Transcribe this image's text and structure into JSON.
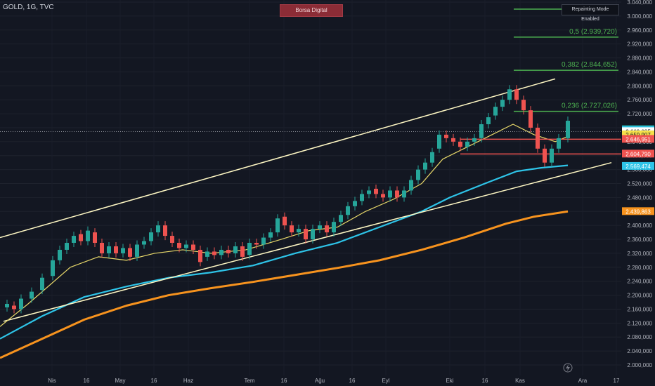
{
  "header": {
    "title": "GOLD, 1G, TVC"
  },
  "badges": {
    "brand": "Borsa Digital",
    "repainting": "Repainting Mode Enabled"
  },
  "colors": {
    "background": "#131722",
    "up": "#26a69a",
    "down": "#ef5350",
    "ema_fast": "#e8d86a",
    "ema_slow": "#2ec4e8",
    "ema_long": "#f7931e",
    "channel": "#fff8c4",
    "fib": "#4caf50"
  },
  "icons": {
    "lightning": "lightning-icon"
  },
  "chart_data": {
    "type": "candlestick",
    "y_axis": {
      "range": [
        1990,
        3040
      ],
      "ticks": [
        "3.040,000",
        "3.000,000",
        "2.960,000",
        "2.920,000",
        "2.880,000",
        "2.840,000",
        "2.800,000",
        "2.760,000",
        "2.720,000",
        "2.680,000",
        "2.640,000",
        "2.600,000",
        "2.560,000",
        "2.520,000",
        "2.480,000",
        "2.440,000",
        "2.400,000",
        "2.360,000",
        "2.320,000",
        "2.280,000",
        "2.240,000",
        "2.200,000",
        "2.160,000",
        "2.120,000",
        "2.080,000",
        "2.040,000",
        "2.000,000"
      ]
    },
    "x_axis": {
      "ticks": [
        "Nis",
        "16",
        "May",
        "16",
        "Haz",
        "Tem",
        "16",
        "Ağu",
        "16",
        "Eyl",
        "Eki",
        "16",
        "Kas",
        "Ara",
        "17"
      ]
    },
    "fibonacci": [
      {
        "label": "0,5 (2.939,720)",
        "value": 2939.72
      },
      {
        "label": "0,382 (2.844,652)",
        "value": 2844.652
      },
      {
        "label": "0,236 (2.727,026)",
        "value": 2727.026
      }
    ],
    "price_labels": [
      {
        "text": "2.674,709",
        "value": 2674.709,
        "color": "#26a69a"
      },
      {
        "text": "2.672,699",
        "value": 2672.699,
        "color": "#2ec4e8"
      },
      {
        "text": "2.669,085",
        "value": 2669.085,
        "color": "#ffffff"
      },
      {
        "text": "2.659,907",
        "value": 2659.907,
        "color": "#f5e04a"
      },
      {
        "text": "2.646,951",
        "value": 2646.951,
        "color": "#ef5350"
      },
      {
        "text": "2.604,790",
        "value": 2604.79,
        "color": "#ef5350"
      },
      {
        "text": "2.569,474",
        "value": 2569.474,
        "color": "#2ec4e8"
      },
      {
        "text": "2.439,863",
        "value": 2439.863,
        "color": "#f7931e"
      }
    ],
    "red_levels": [
      2646.951,
      2604.79
    ],
    "current_price": 2669.085,
    "ema_long": [
      [
        0,
        2020
      ],
      [
        60,
        2075
      ],
      [
        120,
        2130
      ],
      [
        180,
        2170
      ],
      [
        240,
        2200
      ],
      [
        300,
        2220
      ],
      [
        360,
        2238
      ],
      [
        420,
        2258
      ],
      [
        480,
        2278
      ],
      [
        540,
        2300
      ],
      [
        600,
        2330
      ],
      [
        660,
        2365
      ],
      [
        720,
        2405
      ],
      [
        760,
        2425
      ],
      [
        808,
        2440
      ]
    ],
    "ema_slow": [
      [
        0,
        2075
      ],
      [
        60,
        2140
      ],
      [
        120,
        2195
      ],
      [
        180,
        2225
      ],
      [
        240,
        2250
      ],
      [
        300,
        2265
      ],
      [
        360,
        2285
      ],
      [
        420,
        2320
      ],
      [
        480,
        2350
      ],
      [
        540,
        2395
      ],
      [
        600,
        2440
      ],
      [
        640,
        2480
      ],
      [
        690,
        2520
      ],
      [
        735,
        2555
      ],
      [
        770,
        2565
      ],
      [
        808,
        2572
      ]
    ],
    "ema_fast": [
      [
        0,
        2110
      ],
      [
        40,
        2175
      ],
      [
        100,
        2280
      ],
      [
        140,
        2310
      ],
      [
        180,
        2300
      ],
      [
        220,
        2320
      ],
      [
        260,
        2330
      ],
      [
        300,
        2320
      ],
      [
        350,
        2330
      ],
      [
        400,
        2360
      ],
      [
        440,
        2385
      ],
      [
        480,
        2395
      ],
      [
        520,
        2440
      ],
      [
        560,
        2475
      ],
      [
        600,
        2520
      ],
      [
        630,
        2590
      ],
      [
        660,
        2620
      ],
      [
        700,
        2660
      ],
      [
        730,
        2690
      ],
      [
        760,
        2660
      ],
      [
        790,
        2640
      ],
      [
        808,
        2655
      ]
    ],
    "channel_upper": [
      [
        0,
        2365
      ],
      [
        790,
        2820
      ]
    ],
    "channel_lower": [
      [
        5,
        2125
      ],
      [
        870,
        2580
      ]
    ],
    "candles": [
      [
        10,
        2165,
        2175
      ],
      [
        20,
        2170,
        2160
      ],
      [
        30,
        2160,
        2190
      ],
      [
        45,
        2190,
        2210
      ],
      [
        60,
        2215,
        2250
      ],
      [
        75,
        2255,
        2300
      ],
      [
        85,
        2300,
        2330
      ],
      [
        95,
        2330,
        2350
      ],
      [
        105,
        2350,
        2370
      ],
      [
        115,
        2375,
        2355
      ],
      [
        125,
        2355,
        2385
      ],
      [
        135,
        2380,
        2350
      ],
      [
        145,
        2350,
        2320
      ],
      [
        155,
        2320,
        2340
      ],
      [
        165,
        2340,
        2320
      ],
      [
        175,
        2320,
        2335
      ],
      [
        185,
        2335,
        2310
      ],
      [
        195,
        2310,
        2345
      ],
      [
        205,
        2345,
        2355
      ],
      [
        215,
        2355,
        2380
      ],
      [
        225,
        2380,
        2400
      ],
      [
        235,
        2400,
        2370
      ],
      [
        245,
        2370,
        2350
      ],
      [
        255,
        2350,
        2335
      ],
      [
        265,
        2335,
        2345
      ],
      [
        275,
        2345,
        2330
      ],
      [
        285,
        2330,
        2295
      ],
      [
        295,
        2310,
        2325
      ],
      [
        305,
        2325,
        2315
      ],
      [
        315,
        2315,
        2330
      ],
      [
        325,
        2330,
        2320
      ],
      [
        335,
        2320,
        2340
      ],
      [
        345,
        2340,
        2310
      ],
      [
        355,
        2315,
        2350
      ],
      [
        365,
        2350,
        2345
      ],
      [
        375,
        2345,
        2365
      ],
      [
        385,
        2365,
        2380
      ],
      [
        395,
        2380,
        2420
      ],
      [
        405,
        2425,
        2400
      ],
      [
        415,
        2400,
        2380
      ],
      [
        425,
        2380,
        2390
      ],
      [
        435,
        2390,
        2360
      ],
      [
        445,
        2360,
        2390
      ],
      [
        455,
        2390,
        2400
      ],
      [
        465,
        2400,
        2380
      ],
      [
        475,
        2380,
        2410
      ],
      [
        485,
        2410,
        2430
      ],
      [
        495,
        2430,
        2455
      ],
      [
        505,
        2455,
        2470
      ],
      [
        515,
        2470,
        2490
      ],
      [
        525,
        2490,
        2500
      ],
      [
        535,
        2505,
        2490
      ],
      [
        545,
        2490,
        2480
      ],
      [
        555,
        2480,
        2500
      ],
      [
        565,
        2500,
        2480
      ],
      [
        575,
        2480,
        2500
      ],
      [
        585,
        2500,
        2530
      ],
      [
        595,
        2530,
        2560
      ],
      [
        605,
        2560,
        2580
      ],
      [
        615,
        2580,
        2610
      ],
      [
        625,
        2620,
        2660
      ],
      [
        635,
        2660,
        2650
      ],
      [
        645,
        2650,
        2640
      ],
      [
        655,
        2640,
        2625
      ],
      [
        665,
        2625,
        2640
      ],
      [
        675,
        2640,
        2650
      ],
      [
        685,
        2650,
        2690
      ],
      [
        695,
        2690,
        2710
      ],
      [
        705,
        2715,
        2740
      ],
      [
        715,
        2740,
        2760
      ],
      [
        725,
        2760,
        2790
      ],
      [
        735,
        2790,
        2760
      ],
      [
        745,
        2760,
        2730
      ],
      [
        755,
        2730,
        2680
      ],
      [
        765,
        2680,
        2620
      ],
      [
        775,
        2620,
        2580
      ],
      [
        785,
        2580,
        2620
      ],
      [
        795,
        2620,
        2650
      ],
      [
        808,
        2650,
        2700
      ]
    ]
  }
}
